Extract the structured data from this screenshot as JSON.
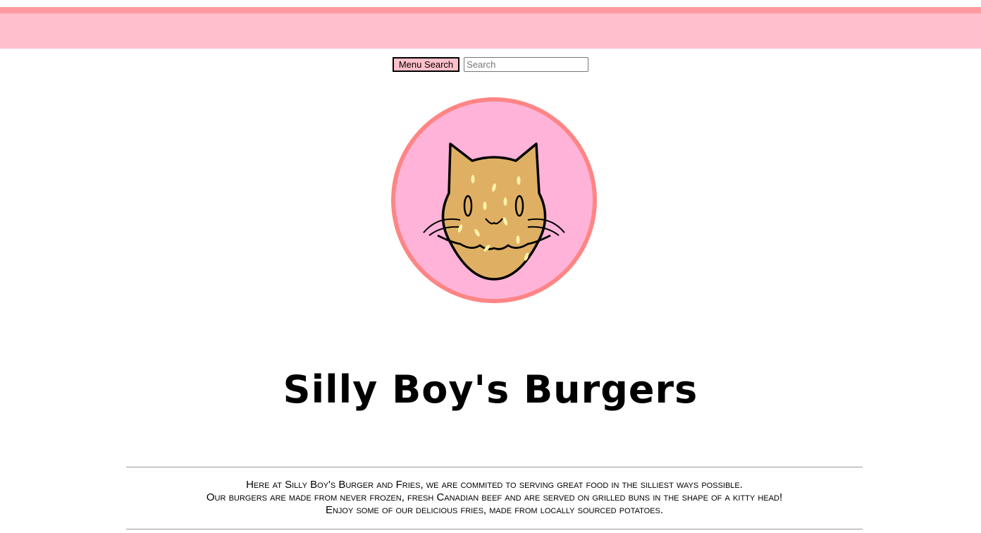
{
  "header": {
    "accent_color": "#ff9a9e",
    "band_color": "#ffc0cb"
  },
  "search": {
    "button_label": "Menu Search",
    "placeholder": "Search",
    "value": ""
  },
  "logo": {
    "icon": "cat-burger-logo",
    "ring_color": "#ff8585",
    "fill_color": "#ffb3d9",
    "bun_color": "#dfb064"
  },
  "title": "Silly Boy's Burgers",
  "about": {
    "lines": [
      "Here at Silly Boy's Burger and Fries, we are commited to serving great food in the silliest ways possible.",
      "Our burgers are made from never frozen, fresh Canadian beef and are served on grilled buns in the shape of a kitty head!",
      "Enjoy some of our delicious fries, made from locally sourced potatoes."
    ]
  }
}
